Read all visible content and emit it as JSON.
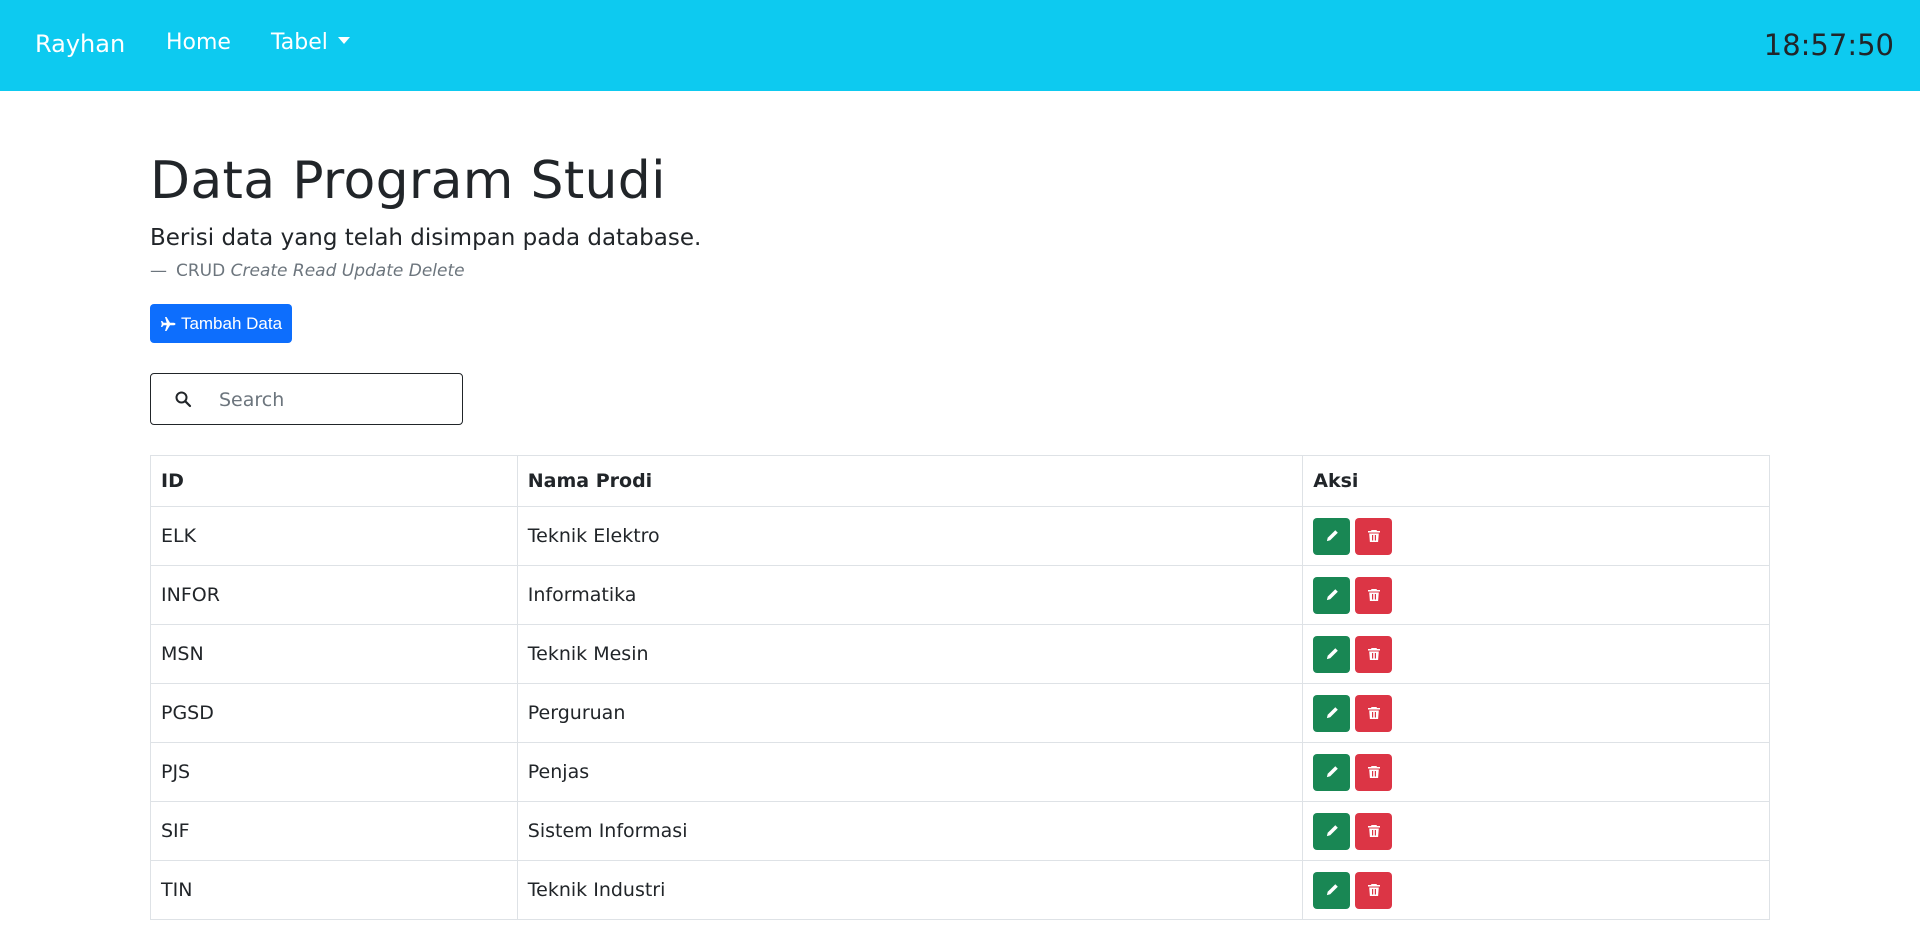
{
  "navbar": {
    "brand": "Rayhan",
    "links": [
      {
        "label": "Home"
      },
      {
        "label": "Tabel"
      }
    ],
    "clock": "18:57:50",
    "bg_color": "#0dcaf0"
  },
  "main": {
    "title": "Data Program Studi",
    "lead": "Berisi data yang telah disimpan pada database.",
    "footer_prefix": "CRUD",
    "footer_cite": "Create Read Update Delete",
    "add_button_label": "Tambah Data",
    "add_button_icon": "plane-icon",
    "search": {
      "placeholder": "Search",
      "value": ""
    }
  },
  "table": {
    "columns": [
      "ID",
      "Nama Prodi",
      "Aksi"
    ],
    "rows": [
      {
        "id": "ELK",
        "nama": "Teknik Elektro"
      },
      {
        "id": "INFOR",
        "nama": "Informatika"
      },
      {
        "id": "MSN",
        "nama": "Teknik Mesin"
      },
      {
        "id": "PGSD",
        "nama": "Perguruan"
      },
      {
        "id": "PJS",
        "nama": "Penjas"
      },
      {
        "id": "SIF",
        "nama": "Sistem Informasi"
      },
      {
        "id": "TIN",
        "nama": "Teknik Industri"
      }
    ],
    "actions": {
      "edit_icon": "pencil-icon",
      "delete_icon": "trash-icon",
      "edit_color": "#198754",
      "delete_color": "#dc3545"
    }
  }
}
